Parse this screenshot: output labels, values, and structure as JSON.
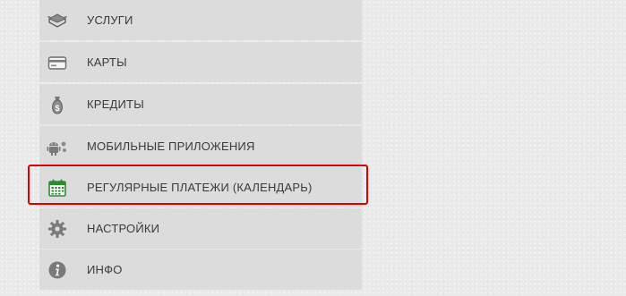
{
  "menu": {
    "items": [
      {
        "label": "УСЛУГИ",
        "icon": "services-box-icon"
      },
      {
        "label": "КАРТЫ",
        "icon": "card-icon"
      },
      {
        "label": "КРЕДИТЫ",
        "icon": "money-bag-icon"
      },
      {
        "label": "МОБИЛЬНЫЕ ПРИЛОЖЕНИЯ",
        "icon": "android-icon"
      },
      {
        "label": "РЕГУЛЯРНЫЕ ПЛАТЕЖИ (КАЛЕНДАРЬ)",
        "icon": "calendar-icon"
      },
      {
        "label": "НАСТРОЙКИ",
        "icon": "gear-icon"
      },
      {
        "label": "ИНФО",
        "icon": "info-icon"
      }
    ]
  },
  "colors": {
    "highlight": "#e00000",
    "calendar_icon": "#2d8a2d",
    "icon_gray": "#6d6d6d",
    "item_bg": "#dcdcdc"
  }
}
